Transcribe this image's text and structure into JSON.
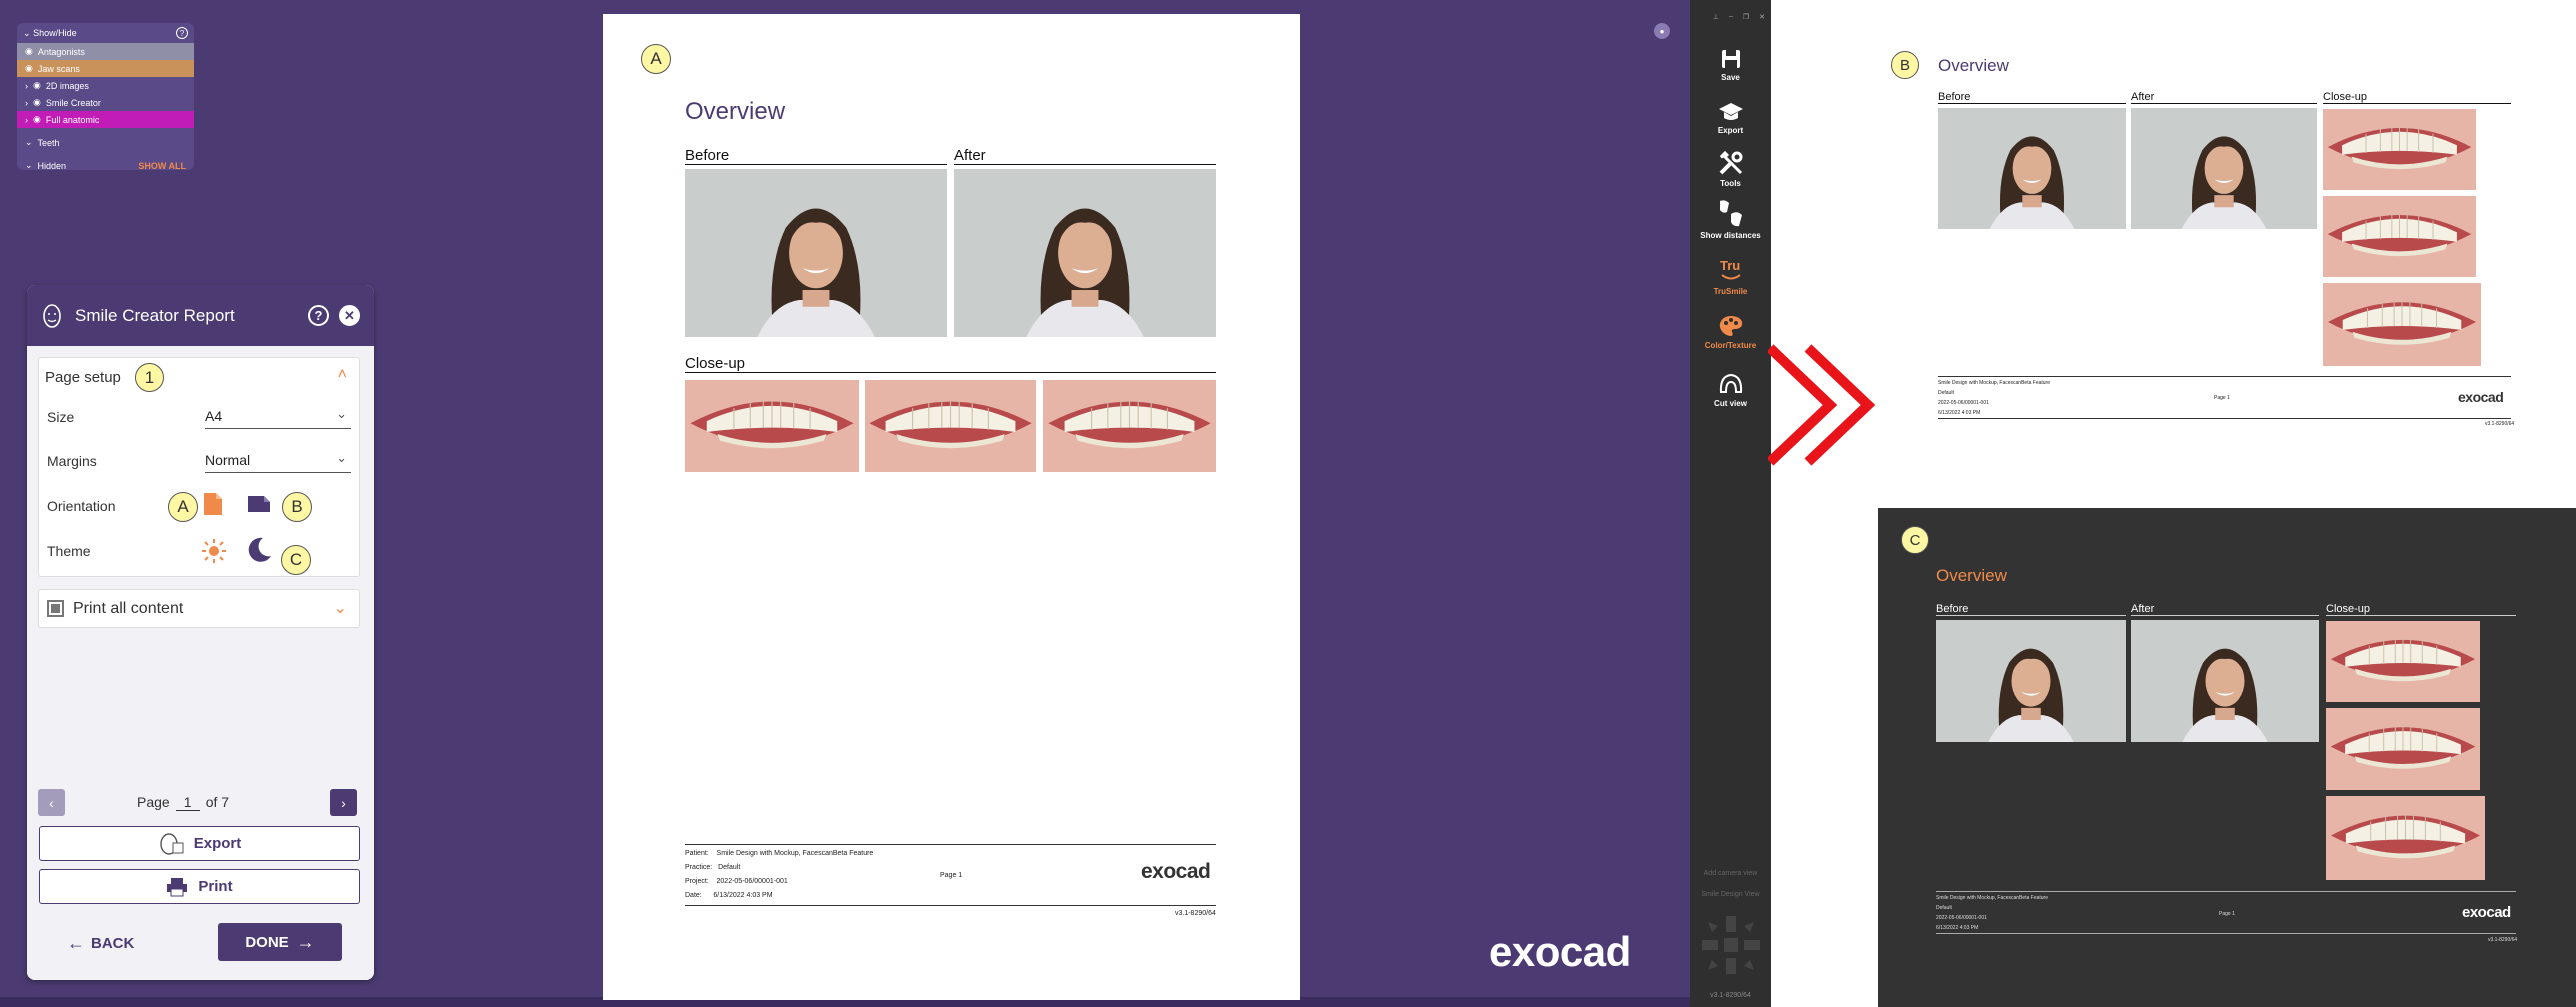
{
  "show_hide": {
    "title": "Show/Hide",
    "items": [
      {
        "label": "Antagonists",
        "color": "#8f8fa8"
      },
      {
        "label": "Jaw scans",
        "color": "#c8925a"
      },
      {
        "label": "2D images",
        "color": ""
      },
      {
        "label": "Smile Creator",
        "color": ""
      },
      {
        "label": "Full anatomic",
        "color": "#c21cb6"
      }
    ],
    "teeth": "Teeth",
    "hidden": "Hidden",
    "show_all": "SHOW ALL"
  },
  "report_panel": {
    "title": "Smile Creator Report",
    "page_setup": "Page setup",
    "page_setup_badge": "1",
    "size_label": "Size",
    "size_value": "A4",
    "margins_label": "Margins",
    "margins_value": "Normal",
    "orientation_label": "Orientation",
    "theme_label": "Theme",
    "print_all": "Print all content",
    "page_prefix": "Page",
    "page_number": "1",
    "page_suffix": "of 7",
    "export": "Export",
    "print": "Print",
    "back": "BACK",
    "done": "DONE",
    "badge_a": "A",
    "badge_b": "B",
    "badge_c": "C"
  },
  "document": {
    "badge": "A",
    "title": "Overview",
    "before": "Before",
    "after": "After",
    "closeup": "Close-up",
    "patient_label": "Patient:",
    "patient_value": "Smile Design with Mockup, FacescanBeta Feature",
    "practice_label": "Practice:",
    "practice_value": "Default",
    "project_label": "Project:",
    "project_value": "2022-05-06/00001-001",
    "date_label": "Date:",
    "date_value": "6/13/2022 4:03 PM",
    "page_label": "Page 1",
    "brand": "exocad",
    "version": "v3.1-8290/64"
  },
  "watermark_brand": "exocad",
  "toolbar": {
    "save": "Save",
    "export": "Export",
    "tools": "Tools",
    "show_distances": "Show distances",
    "trusmile": "TruSmile",
    "color_texture": "Color/Texture",
    "cut_view": "Cut view",
    "add_camera": "Add camera view",
    "smile_design": "Smile Design View",
    "version": "v3.1-8290/64"
  },
  "preview_b": {
    "badge": "B",
    "title": "Overview",
    "before": "Before",
    "after": "After",
    "closeup": "Close-up",
    "patient": "Smile Design with Mockup, FacescanBeta Feature",
    "practice": "Default",
    "project": "2022-05-06/00001-001",
    "date": "6/13/2022 4:03 PM",
    "page": "Page 1",
    "brand": "exocad",
    "version": "v3.1-8290/64"
  },
  "preview_c": {
    "badge": "C",
    "title": "Overview",
    "before": "Before",
    "after": "After",
    "closeup": "Close-up",
    "patient": "Smile Design with Mockup, FacescanBeta Feature",
    "practice": "Default",
    "project": "2022-05-06/00001-001",
    "date": "6/13/2022 4:03 PM",
    "page": "Page 1",
    "brand": "exocad",
    "version": "v3.1-8290/64"
  },
  "colors": {
    "brand_purple": "#4b3b72",
    "accent_orange": "#f08a4a",
    "badge_yellow": "#fff7a3",
    "chevron_red": "#e8141a"
  }
}
